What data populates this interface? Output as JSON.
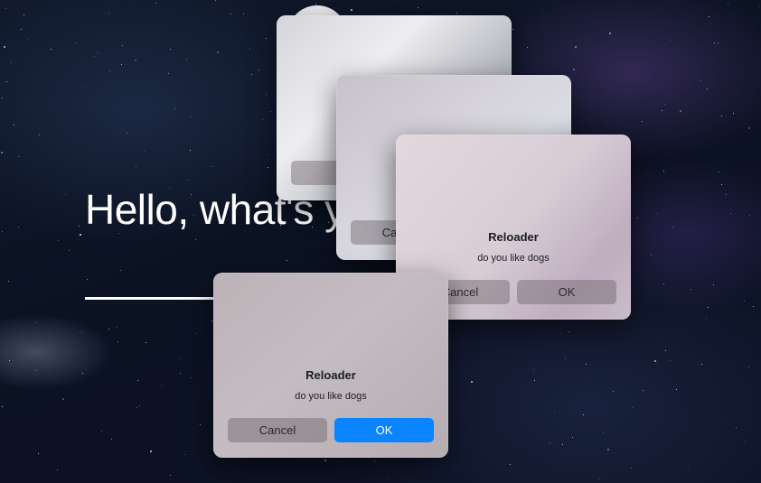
{
  "background": {
    "greeting": "Hello, what's your name?"
  },
  "dialogs": [
    {
      "title": "",
      "message": "",
      "cancel_label": "",
      "ok_label": ""
    },
    {
      "title": "",
      "message": "",
      "cancel_label": "Cancel",
      "ok_label": ""
    },
    {
      "title": "Reloader",
      "message": "do you like dogs",
      "cancel_label": "Cancel",
      "ok_label": "OK"
    },
    {
      "title": "Reloader",
      "message": "do you like dogs",
      "cancel_label": "Cancel",
      "ok_label": "OK",
      "ok_color": "#0a84ff"
    }
  ]
}
